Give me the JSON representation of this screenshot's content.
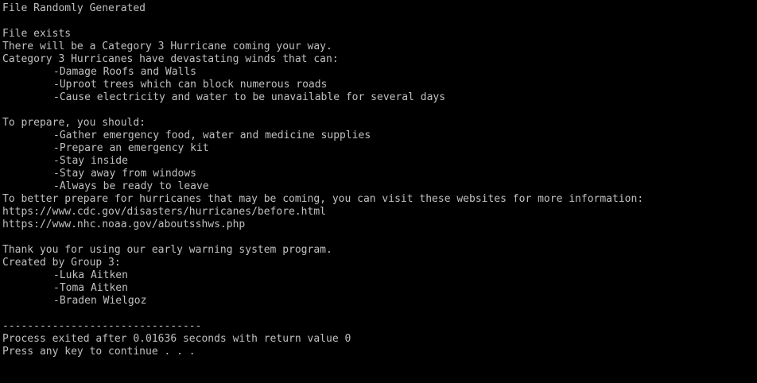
{
  "console": {
    "colors": {
      "background": "#000000",
      "text": "#c0c0c0"
    },
    "lines": [
      "File Randomly Generated",
      "",
      "File exists",
      "There will be a Category 3 Hurricane coming your way.",
      "Category 3 Hurricanes have devastating winds that can:",
      "-Damage Roofs and Walls",
      "-Uproot trees which can block numerous roads",
      "-Cause electricity and water to be unavailable for several days",
      "",
      "To prepare, you should:",
      "-Gather emergency food, water and medicine supplies",
      "-Prepare an emergency kit",
      "-Stay inside",
      "-Stay away from windows",
      "-Always be ready to leave",
      "To better prepare for hurricanes that may be coming, you can visit these websites for more information:",
      "https://www.cdc.gov/disasters/hurricanes/before.html",
      "https://www.nhc.noaa.gov/aboutsshws.php",
      "",
      "Thank you for using our early warning system program.",
      "Created by Group 3:",
      "-Luka Aitken",
      "-Toma Aitken",
      "-Braden Wielgoz",
      "",
      "--------------------------------",
      "Process exited after 0.01636 seconds with return value 0",
      "Press any key to continue . . ."
    ]
  }
}
